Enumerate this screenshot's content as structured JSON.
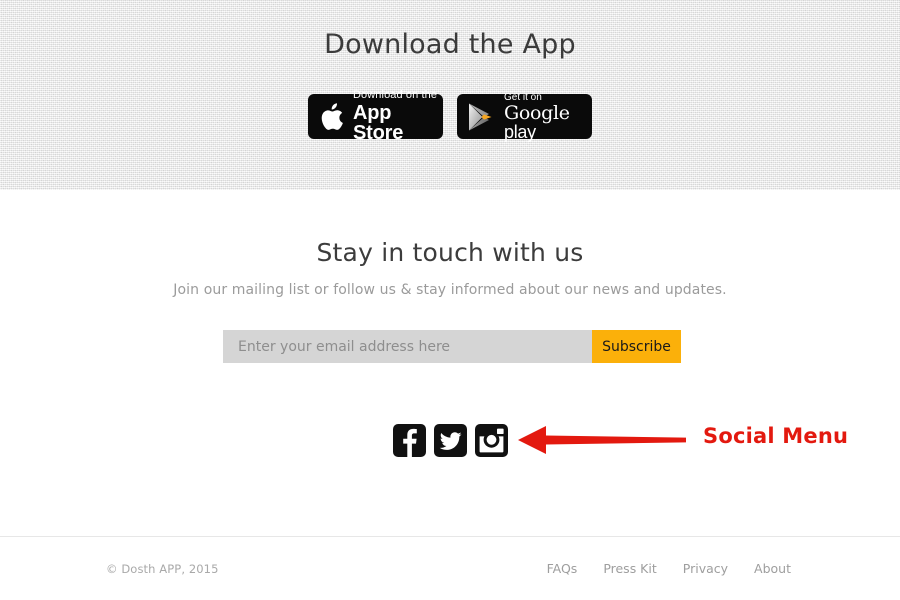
{
  "download_section": {
    "title": "Download the App",
    "badges": [
      {
        "icon": "apple-logo-icon",
        "small_label": "Download on the",
        "big_label": "App Store"
      },
      {
        "icon": "google-play-triangle-icon",
        "small_label": "Get it on",
        "big_label_google": "Google",
        "big_label_play": "play"
      }
    ]
  },
  "newsletter": {
    "title": "Stay in touch with us",
    "subtitle": "Join our mailing list or follow us & stay informed about our news and updates.",
    "email_placeholder": "Enter your email address here",
    "email_value": "",
    "subscribe_label": "Subscribe"
  },
  "social": {
    "items": [
      {
        "name": "facebook-icon"
      },
      {
        "name": "twitter-icon"
      },
      {
        "name": "instagram-icon"
      }
    ]
  },
  "annotation": {
    "label": "Social Menu",
    "color": "#e3190f",
    "arrow_direction": "left"
  },
  "footer": {
    "copyright": "© Dosth APP, 2015",
    "links": [
      {
        "label": "FAQs"
      },
      {
        "label": "Press Kit"
      },
      {
        "label": "Privacy"
      },
      {
        "label": "About"
      }
    ]
  },
  "colors": {
    "accent_amber": "#fbb00a",
    "annotation_red": "#e3190f",
    "input_grey": "#d5d5d5",
    "textured_bg": "#ececec"
  }
}
